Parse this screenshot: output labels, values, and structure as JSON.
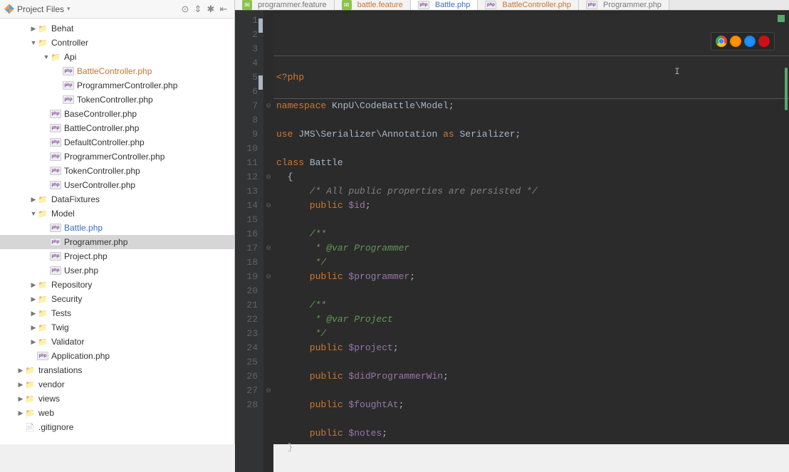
{
  "sidebar": {
    "title": "Project Files",
    "tree": [
      {
        "depth": 2,
        "arrow": "right",
        "icon": "folder",
        "text": "Behat"
      },
      {
        "depth": 2,
        "arrow": "down",
        "icon": "folder",
        "text": "Controller"
      },
      {
        "depth": 3,
        "arrow": "down",
        "icon": "folder",
        "text": "Api"
      },
      {
        "depth": 4,
        "arrow": "",
        "icon": "php",
        "text": "BattleController.php",
        "cls": "orange"
      },
      {
        "depth": 4,
        "arrow": "",
        "icon": "php",
        "text": "ProgrammerController.php"
      },
      {
        "depth": 4,
        "arrow": "",
        "icon": "php",
        "text": "TokenController.php"
      },
      {
        "depth": 3,
        "arrow": "",
        "icon": "php",
        "text": "BaseController.php"
      },
      {
        "depth": 3,
        "arrow": "",
        "icon": "php",
        "text": "BattleController.php"
      },
      {
        "depth": 3,
        "arrow": "",
        "icon": "php",
        "text": "DefaultController.php"
      },
      {
        "depth": 3,
        "arrow": "",
        "icon": "php",
        "text": "ProgrammerController.php"
      },
      {
        "depth": 3,
        "arrow": "",
        "icon": "php",
        "text": "TokenController.php"
      },
      {
        "depth": 3,
        "arrow": "",
        "icon": "php",
        "text": "UserController.php"
      },
      {
        "depth": 2,
        "arrow": "right",
        "icon": "folder",
        "text": "DataFixtures"
      },
      {
        "depth": 2,
        "arrow": "down",
        "icon": "folder",
        "text": "Model"
      },
      {
        "depth": 3,
        "arrow": "",
        "icon": "php",
        "text": "Battle.php",
        "cls": "blue"
      },
      {
        "depth": 3,
        "arrow": "",
        "icon": "php",
        "text": "Programmer.php",
        "selected": true
      },
      {
        "depth": 3,
        "arrow": "",
        "icon": "php",
        "text": "Project.php"
      },
      {
        "depth": 3,
        "arrow": "",
        "icon": "php",
        "text": "User.php"
      },
      {
        "depth": 2,
        "arrow": "right",
        "icon": "folder",
        "text": "Repository"
      },
      {
        "depth": 2,
        "arrow": "right",
        "icon": "folder",
        "text": "Security"
      },
      {
        "depth": 2,
        "arrow": "right",
        "icon": "folder",
        "text": "Tests"
      },
      {
        "depth": 2,
        "arrow": "right",
        "icon": "folder",
        "text": "Twig"
      },
      {
        "depth": 2,
        "arrow": "right",
        "icon": "folder",
        "text": "Validator"
      },
      {
        "depth": 2,
        "arrow": "",
        "icon": "php",
        "text": "Application.php"
      },
      {
        "depth": 1,
        "arrow": "right",
        "icon": "folder",
        "text": "translations"
      },
      {
        "depth": 1,
        "arrow": "right",
        "icon": "folder",
        "text": "vendor"
      },
      {
        "depth": 1,
        "arrow": "right",
        "icon": "folder",
        "text": "views"
      },
      {
        "depth": 1,
        "arrow": "right",
        "icon": "folder",
        "text": "web"
      },
      {
        "depth": 1,
        "arrow": "",
        "icon": "file",
        "text": ".gitignore"
      }
    ]
  },
  "tabs": [
    {
      "icon": "feature",
      "text": "programmer.feature",
      "cls": "tab-grey"
    },
    {
      "icon": "feature",
      "text": "battle.feature",
      "cls": "tab-orange"
    },
    {
      "icon": "php",
      "text": "Battle.php",
      "cls": "tab-blue",
      "active": true
    },
    {
      "icon": "php",
      "text": "BattleController.php",
      "cls": "tab-orange"
    },
    {
      "icon": "php",
      "text": "Programmer.php",
      "cls": "tab-grey"
    }
  ],
  "code": {
    "lines": [
      [
        [
          "kw",
          "<?php"
        ]
      ],
      [],
      [
        [
          "kw",
          "namespace "
        ],
        [
          "ns",
          "KnpU\\CodeBattle\\Model"
        ],
        [
          "str",
          ";"
        ]
      ],
      [],
      [
        [
          "kw",
          "use "
        ],
        [
          "ns",
          "JMS\\Serializer\\Annotation"
        ],
        [
          "kw",
          " as "
        ],
        [
          "ns",
          "Serializer"
        ],
        [
          "str",
          ";"
        ]
      ],
      [],
      [
        [
          "kw",
          "class "
        ],
        [
          "type",
          "Battle"
        ]
      ],
      [
        [
          "str",
          "  {"
        ]
      ],
      [
        [
          "com",
          "      /* All public properties are persisted */"
        ]
      ],
      [
        [
          "kw",
          "      public "
        ],
        [
          "var",
          "$id"
        ],
        [
          "str",
          ";"
        ]
      ],
      [],
      [
        [
          "doc",
          "      /**"
        ]
      ],
      [
        [
          "doc",
          "       * @var Programmer"
        ]
      ],
      [
        [
          "doc",
          "       */"
        ]
      ],
      [
        [
          "kw",
          "      public "
        ],
        [
          "var",
          "$programmer"
        ],
        [
          "str",
          ";"
        ]
      ],
      [],
      [
        [
          "doc",
          "      /**"
        ]
      ],
      [
        [
          "doc",
          "       * @var Project"
        ]
      ],
      [
        [
          "doc",
          "       */"
        ]
      ],
      [
        [
          "kw",
          "      public "
        ],
        [
          "var",
          "$project"
        ],
        [
          "str",
          ";"
        ]
      ],
      [],
      [
        [
          "kw",
          "      public "
        ],
        [
          "var",
          "$didProgrammerWin"
        ],
        [
          "str",
          ";"
        ]
      ],
      [],
      [
        [
          "kw",
          "      public "
        ],
        [
          "var",
          "$foughtAt"
        ],
        [
          "str",
          ";"
        ]
      ],
      [],
      [
        [
          "kw",
          "      public "
        ],
        [
          "var",
          "$notes"
        ],
        [
          "str",
          ";"
        ]
      ],
      [
        [
          "str",
          "  }"
        ]
      ],
      []
    ],
    "fold": {
      "7": "⊖",
      "8": "",
      "12": "⊖",
      "14": "⊖",
      "17": "⊖",
      "19": "⊖",
      "27": "⊖"
    }
  }
}
